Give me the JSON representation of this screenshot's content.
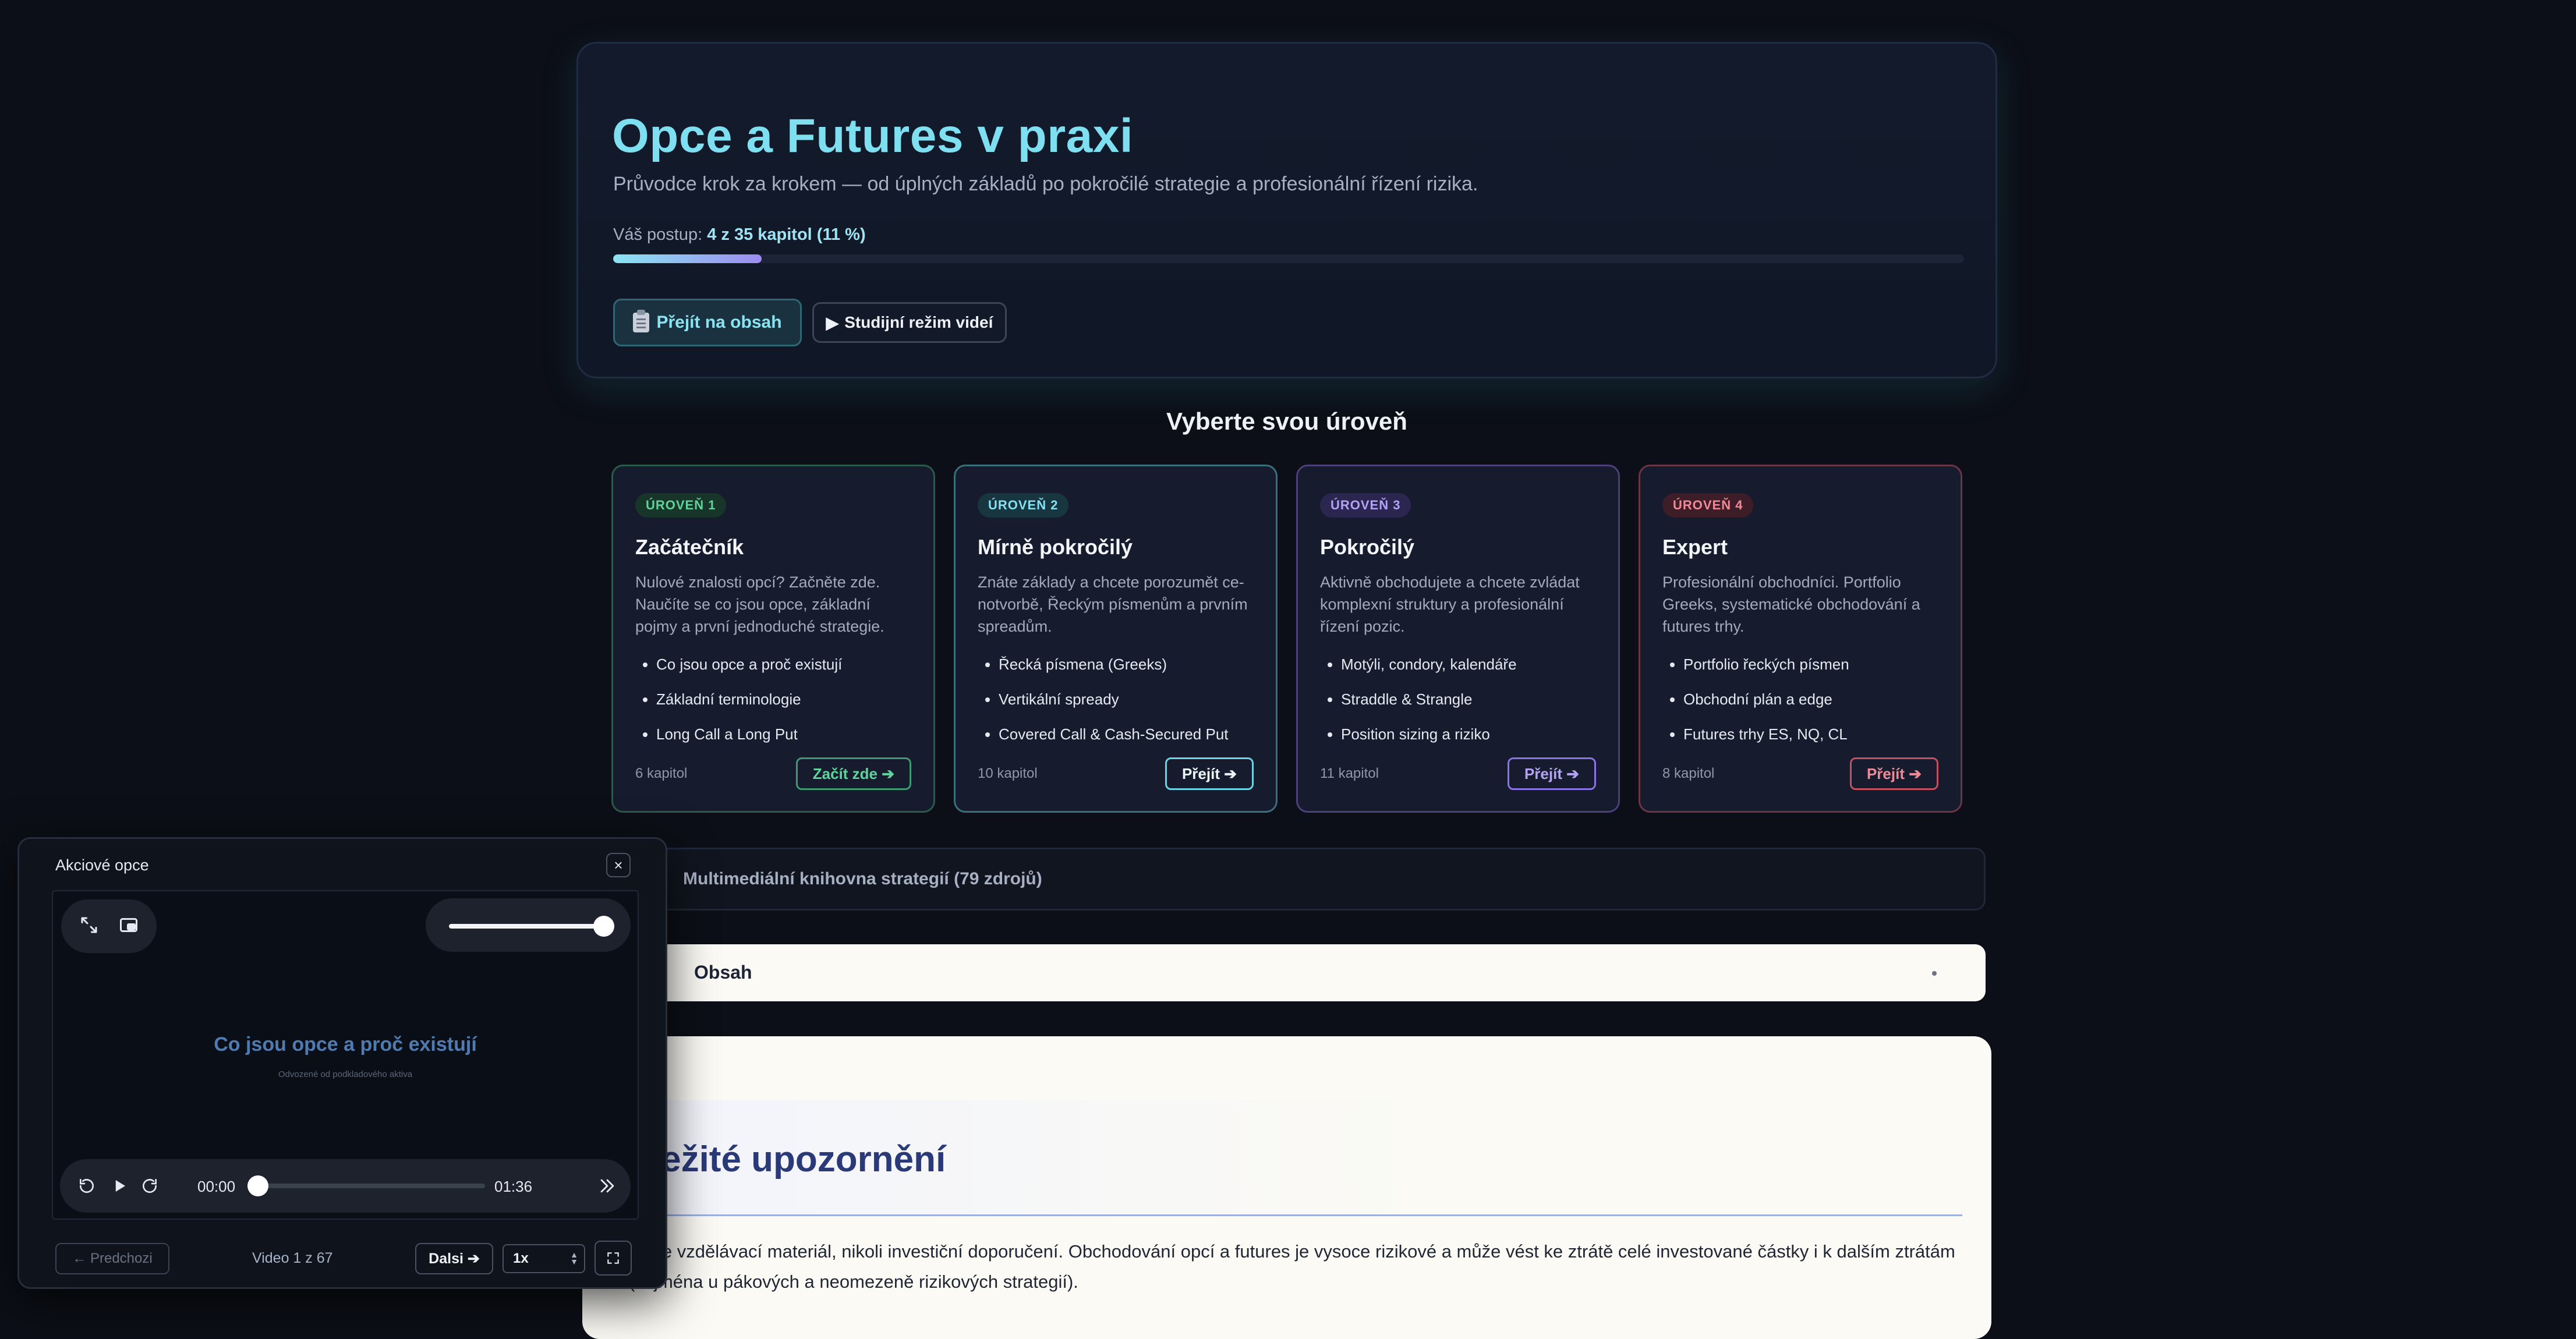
{
  "hero": {
    "title": "Opce a Futures v praxi",
    "subtitle": "Průvodce krok za krokem — od úplných základů po pokročilé strategie a profesionální řízení rizika.",
    "progress_prefix": "Váš postup:",
    "progress_value": "4 z 35 kapitol (11 %)",
    "progress_fraction": 0.11,
    "btn_contents": "Přejít na obsah",
    "btn_study": "Studijní režim videí"
  },
  "levels_title": "Vyberte svou úroveň",
  "levels": [
    {
      "badge": "ÚROVEŇ 1",
      "title": "Začátečník",
      "desc": "Nulové znalosti opcí? Začněte zde. Naučíte se co jsou opce, základní pojmy a první jednoduché strategie.",
      "items": [
        "Co jsou opce a proč existují",
        "Základní terminologie",
        "Long Call a Long Put"
      ],
      "count": "6 kapitol",
      "button": "Začít zde ➔",
      "accent": "#5fd39b"
    },
    {
      "badge": "ÚROVEŇ 2",
      "title": "Mírně pokročilý",
      "desc": "Znáte základy a chcete porozumět ce­notvorbě, Řeckým písmenům a prvním spreadům.",
      "items": [
        "Řecká písmena (Greeks)",
        "Vertikální spready",
        "Covered Call & Cash-Secured Put"
      ],
      "count": "10 kapitol",
      "button": "Přejít ➔",
      "accent": "#86e0f0"
    },
    {
      "badge": "ÚROVEŇ 3",
      "title": "Pokročilý",
      "desc": "Aktivně obchodujete a chcete zvládat komplexní struktury a profesionální řízení pozic.",
      "items": [
        "Motýli, condory, kalendáře",
        "Straddle & Strangle",
        "Position sizing a riziko"
      ],
      "count": "11 kapitol",
      "button": "Přejít ➔",
      "accent": "#b4a2f5"
    },
    {
      "badge": "ÚROVEŇ 4",
      "title": "Expert",
      "desc": "Profesionální obchodníci. Portfolio Greeks, systematické obchodování a futures trhy.",
      "items": [
        "Portfolio řeckých písmen",
        "Obchodní plán a edge",
        "Futures trhy ES, NQ, CL"
      ],
      "count": "8 kapitol",
      "button": "Přejít ➔",
      "accent": "#f08a96"
    }
  ],
  "library_label": "Multimediální knihovna strategií (79 zdrojů)",
  "toc_label": "Obsah",
  "notice": {
    "title": "ůležité upozornění",
    "text": "ext je vzdělávací materiál, nikoli investiční doporučení. Obchodování opcí a futures je vysoce rizikové a může vést ke ztrátě celé investované částky i k dalším ztrátám (zejména u pákových a neomezeně rizikových strategií)."
  },
  "video": {
    "panel_title": "Akciové opce",
    "close": "×",
    "slide_title": "Co jsou opce a proč existují",
    "slide_subtitle": "Odvozené od podkladového aktiva",
    "time_current": "00:00",
    "time_total": "01:36",
    "volume_fraction": 1.0,
    "prev": "← Predchozi",
    "counter": "Video 1 z 67",
    "next": "Dalsi ➔",
    "speed": "1x"
  }
}
